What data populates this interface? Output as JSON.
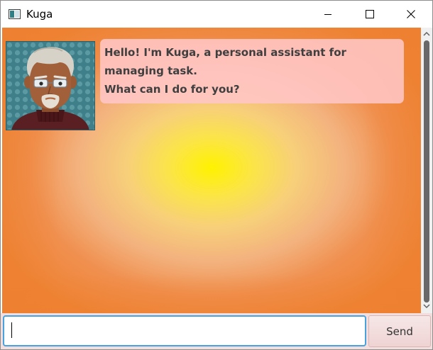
{
  "window": {
    "title": "Kuga",
    "app_icon": "window-app-icon",
    "controls": {
      "minimize_icon": "minimize-icon",
      "maximize_icon": "maximize-icon",
      "close_icon": "close-icon"
    }
  },
  "chat": {
    "messages": [
      {
        "sender": "Kuga",
        "avatar_icon": "kuga-avatar",
        "lines": [
          "Hello! I'm Kuga, a personal assistant for managing task.",
          "What can I do for you?"
        ]
      }
    ]
  },
  "input": {
    "value": "",
    "placeholder": ""
  },
  "send_button": {
    "label": "Send"
  },
  "colors": {
    "background_center": "#fff200",
    "background_edge": "#ee8333",
    "bubble": "#ffc6c6",
    "input_focus_border": "#46a3df",
    "input_bar": "#f4dddd"
  }
}
